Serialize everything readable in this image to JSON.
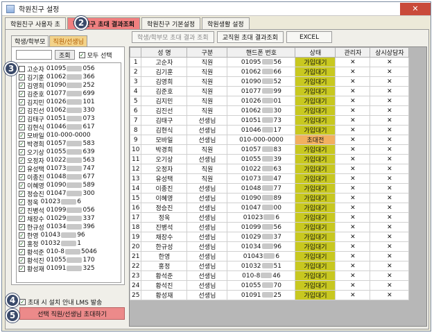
{
  "window": {
    "title": "학원친구 설정",
    "close_symbol": "✕"
  },
  "tabs": [
    "학원친구 사용자 초",
    "학원친구 초대 결과조회",
    "학원친구 기본설정",
    "학원생활 설정"
  ],
  "badges": {
    "b2": "2",
    "b3": "3",
    "b4": "4",
    "b5": "5"
  },
  "left": {
    "subtabs": [
      "학생/학부모",
      "직원/선생님"
    ],
    "search_button": "조회",
    "select_all": "모두 선택",
    "people": [
      {
        "name": "고순자",
        "pre": "01095",
        "post": "056",
        "checked": false
      },
      {
        "name": "김기훈",
        "pre": "01062",
        "post": "366",
        "checked": true
      },
      {
        "name": "김영희",
        "pre": "01090",
        "post": "252",
        "checked": true
      },
      {
        "name": "김준호",
        "pre": "01077",
        "post": "699",
        "checked": true
      },
      {
        "name": "김지민",
        "pre": "01026",
        "post": "101",
        "checked": true
      },
      {
        "name": "김진선",
        "pre": "01062",
        "post": "330",
        "checked": true
      },
      {
        "name": "김태구",
        "pre": "01051",
        "post": "073",
        "checked": true
      },
      {
        "name": "김현식",
        "pre": "01046",
        "post": "617",
        "checked": true
      },
      {
        "name": "모바일",
        "pre": "010-000-0000",
        "post": "",
        "checked": true
      },
      {
        "name": "박경희",
        "pre": "01057",
        "post": "583",
        "checked": true
      },
      {
        "name": "오기상",
        "pre": "01055",
        "post": "639",
        "checked": true
      },
      {
        "name": "오정자",
        "pre": "01022",
        "post": "563",
        "checked": true
      },
      {
        "name": "유성택",
        "pre": "01073",
        "post": "747",
        "checked": true
      },
      {
        "name": "이종진",
        "pre": "01048",
        "post": "677",
        "checked": true
      },
      {
        "name": "이혜영",
        "pre": "01090",
        "post": "589",
        "checked": true
      },
      {
        "name": "정승진",
        "pre": "01047",
        "post": "300",
        "checked": true
      },
      {
        "name": "정욱",
        "pre": "01023",
        "post": "6",
        "checked": true
      },
      {
        "name": "진병석",
        "pre": "01099",
        "post": "056",
        "checked": true
      },
      {
        "name": "채장수",
        "pre": "01029",
        "post": "337",
        "checked": true
      },
      {
        "name": "한규성",
        "pre": "01034",
        "post": "396",
        "checked": true
      },
      {
        "name": "한영",
        "pre": "01043",
        "post": "96",
        "checked": true
      },
      {
        "name": "홍정",
        "pre": "01032",
        "post": "1",
        "checked": true
      },
      {
        "name": "황석준",
        "pre": "010-8",
        "post": "5046",
        "checked": true
      },
      {
        "name": "황석진",
        "pre": "01055",
        "post": "170",
        "checked": true
      },
      {
        "name": "황성재",
        "pre": "01091",
        "post": "325",
        "checked": true
      }
    ],
    "lms_label": "초대 시 설치 안내 LMS 발송",
    "invite_button": "선택 직원/선생님 초대하기"
  },
  "right": {
    "buttons": [
      "학생/학부모 초대 결과 조회",
      "교직원 초대 결과조회",
      "EXCEL"
    ],
    "columns": [
      "",
      "성 명",
      "구분",
      "핸드폰 번호",
      "상태",
      "관리자",
      "상시상담자"
    ],
    "rows": [
      {
        "no": "1",
        "name": "고순자",
        "type": "직원",
        "pre": "01095",
        "post": "56",
        "status": "가입대기",
        "admin": "✕",
        "counsel": "✕"
      },
      {
        "no": "2",
        "name": "김기훈",
        "type": "직원",
        "pre": "01062",
        "post": "66",
        "status": "가입대기",
        "admin": "✕",
        "counsel": "✕"
      },
      {
        "no": "3",
        "name": "김영희",
        "type": "직원",
        "pre": "01090",
        "post": "52",
        "status": "가입대기",
        "admin": "✕",
        "counsel": "✕"
      },
      {
        "no": "4",
        "name": "김준호",
        "type": "직원",
        "pre": "01077",
        "post": "99",
        "status": "가입대기",
        "admin": "✕",
        "counsel": "✕"
      },
      {
        "no": "5",
        "name": "김지민",
        "type": "직원",
        "pre": "01026",
        "post": "01",
        "status": "가입대기",
        "admin": "✕",
        "counsel": "✕"
      },
      {
        "no": "6",
        "name": "김진선",
        "type": "직원",
        "pre": "01062",
        "post": "30",
        "status": "가입대기",
        "admin": "✕",
        "counsel": "✕"
      },
      {
        "no": "7",
        "name": "김태구",
        "type": "선생님",
        "pre": "01051",
        "post": "73",
        "status": "가입대기",
        "admin": "✕",
        "counsel": "✕"
      },
      {
        "no": "8",
        "name": "김현식",
        "type": "선생님",
        "pre": "01046",
        "post": "17",
        "status": "가입대기",
        "admin": "✕",
        "counsel": "✕"
      },
      {
        "no": "9",
        "name": "모바일",
        "type": "선생님",
        "pre": "010-000-0000",
        "post": "",
        "status": "초대전",
        "admin": "✕",
        "counsel": "✕"
      },
      {
        "no": "10",
        "name": "박경희",
        "type": "직원",
        "pre": "01057",
        "post": "83",
        "status": "가입대기",
        "admin": "✕",
        "counsel": "✕"
      },
      {
        "no": "11",
        "name": "오기상",
        "type": "선생님",
        "pre": "01055",
        "post": "39",
        "status": "가입대기",
        "admin": "✕",
        "counsel": "✕"
      },
      {
        "no": "12",
        "name": "오정자",
        "type": "직원",
        "pre": "01022",
        "post": "63",
        "status": "가입대기",
        "admin": "✕",
        "counsel": "✕"
      },
      {
        "no": "13",
        "name": "유성택",
        "type": "직원",
        "pre": "01073",
        "post": "47",
        "status": "가입대기",
        "admin": "✕",
        "counsel": "✕"
      },
      {
        "no": "14",
        "name": "이종진",
        "type": "선생님",
        "pre": "01048",
        "post": "77",
        "status": "가입대기",
        "admin": "✕",
        "counsel": "✕"
      },
      {
        "no": "15",
        "name": "이혜영",
        "type": "선생님",
        "pre": "01090",
        "post": "89",
        "status": "가입대기",
        "admin": "✕",
        "counsel": "✕"
      },
      {
        "no": "16",
        "name": "정승진",
        "type": "선생님",
        "pre": "01047",
        "post": "00",
        "status": "가입대기",
        "admin": "✕",
        "counsel": "✕"
      },
      {
        "no": "17",
        "name": "정욱",
        "type": "선생님",
        "pre": "01023",
        "post": "6",
        "status": "가입대기",
        "admin": "✕",
        "counsel": "✕"
      },
      {
        "no": "18",
        "name": "진병석",
        "type": "선생님",
        "pre": "01099",
        "post": "56",
        "status": "가입대기",
        "admin": "✕",
        "counsel": "✕"
      },
      {
        "no": "19",
        "name": "채장수",
        "type": "선생님",
        "pre": "01029",
        "post": "37",
        "status": "가입대기",
        "admin": "✕",
        "counsel": "✕"
      },
      {
        "no": "20",
        "name": "한규성",
        "type": "선생님",
        "pre": "01034",
        "post": "96",
        "status": "가입대기",
        "admin": "✕",
        "counsel": "✕"
      },
      {
        "no": "21",
        "name": "한영",
        "type": "선생님",
        "pre": "01043",
        "post": "6",
        "status": "가입대기",
        "admin": "✕",
        "counsel": "✕"
      },
      {
        "no": "22",
        "name": "홍정",
        "type": "선생님",
        "pre": "01032",
        "post": "51",
        "status": "가입대기",
        "admin": "✕",
        "counsel": "✕"
      },
      {
        "no": "23",
        "name": "황석준",
        "type": "선생님",
        "pre": "010-8",
        "post": "46",
        "status": "가입대기",
        "admin": "✕",
        "counsel": "✕"
      },
      {
        "no": "24",
        "name": "황석진",
        "type": "선생님",
        "pre": "01055",
        "post": "70",
        "status": "가입대기",
        "admin": "✕",
        "counsel": "✕"
      },
      {
        "no": "25",
        "name": "황성재",
        "type": "선생님",
        "pre": "01091",
        "post": "25",
        "status": "가입대기",
        "admin": "✕",
        "counsel": "✕"
      }
    ]
  }
}
